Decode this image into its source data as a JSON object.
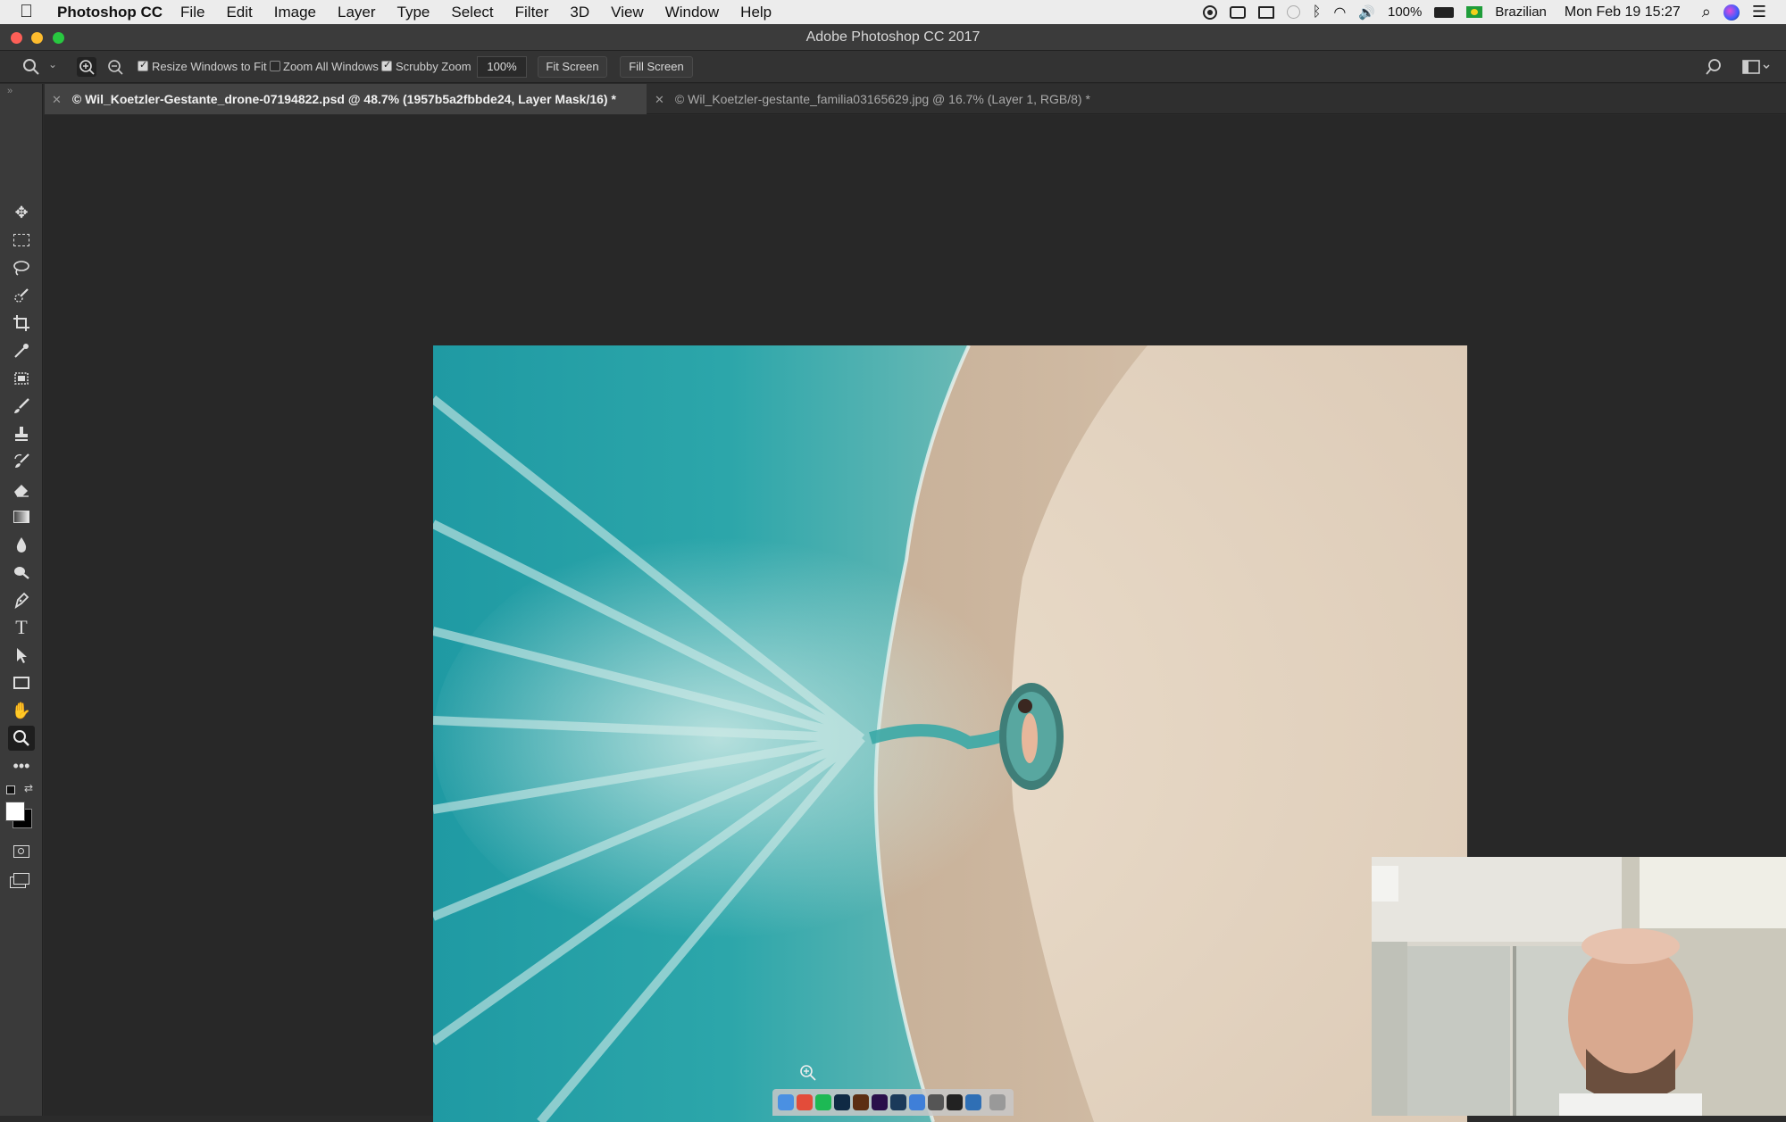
{
  "menubar": {
    "app_name": "Photoshop CC",
    "items": [
      "File",
      "Edit",
      "Image",
      "Layer",
      "Type",
      "Select",
      "Filter",
      "3D",
      "View",
      "Window",
      "Help"
    ],
    "battery": "100%",
    "input_source": "Brazilian",
    "datetime": "Mon Feb 19  15:27"
  },
  "window": {
    "title": "Adobe Photoshop CC 2017"
  },
  "options": {
    "resize_windows": "Resize Windows to Fit",
    "zoom_all": "Zoom All Windows",
    "scrubby_zoom": "Scrubby Zoom",
    "zoom_value": "100%",
    "fit_screen": "Fit Screen",
    "fill_screen": "Fill Screen",
    "resize_checked": true,
    "zoom_all_checked": false,
    "scrubby_checked": true
  },
  "tabs": [
    {
      "close": "✕",
      "label": "© Wil_Koetzler-Gestante_drone-07194822.psd @ 48.7% (1957b5a2fbbde24, Layer Mask/16) *",
      "active": true
    },
    {
      "close": "✕",
      "label": "© Wil_Koetzler-gestante_familia03165629.jpg @ 16.7% (Layer 1, RGB/8) *",
      "active": false
    }
  ],
  "tools": [
    "move-tool",
    "marquee-tool",
    "lasso-tool",
    "quick-selection-tool",
    "crop-tool",
    "eyedropper-tool",
    "healing-brush-tool",
    "brush-tool",
    "clone-stamp-tool",
    "history-brush-tool",
    "eraser-tool",
    "gradient-tool",
    "blur-tool",
    "dodge-tool",
    "pen-tool",
    "type-tool",
    "path-selection-tool",
    "rectangle-tool",
    "hand-tool",
    "zoom-tool",
    "edit-toolbar"
  ],
  "colors": {
    "menubar_bg": "#ececec",
    "ps_dark": "#2b2b2b",
    "sea": "#2aa3a8",
    "sand": "#e4d6c4"
  }
}
